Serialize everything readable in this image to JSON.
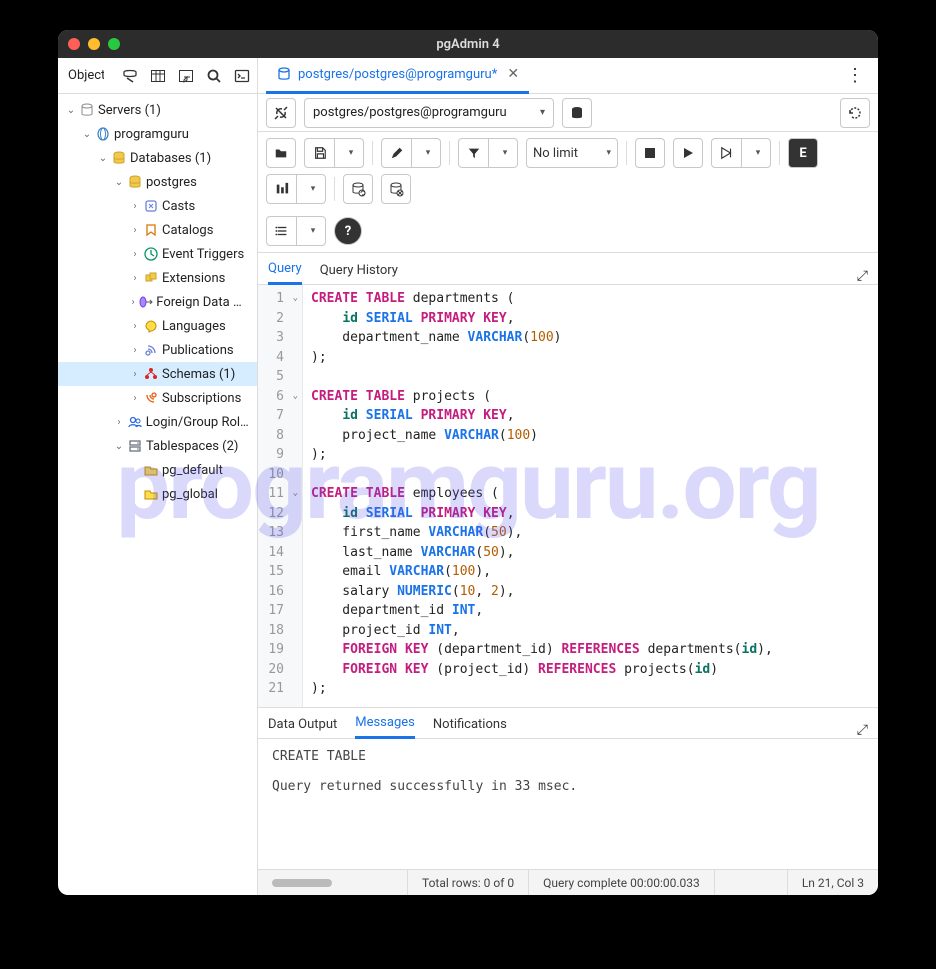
{
  "window": {
    "title": "pgAdmin 4"
  },
  "watermark": "programguru.org",
  "sidebar": {
    "tab_label": "Object",
    "items": [
      {
        "depth": 0,
        "toggle": "down",
        "icon": "servers",
        "label": "Servers (1)"
      },
      {
        "depth": 1,
        "toggle": "down",
        "icon": "server",
        "label": "programguru"
      },
      {
        "depth": 2,
        "toggle": "down",
        "icon": "database-group",
        "label": "Databases (1)"
      },
      {
        "depth": 3,
        "toggle": "down",
        "icon": "database",
        "label": "postgres"
      },
      {
        "depth": 4,
        "toggle": "right",
        "icon": "casts",
        "label": "Casts"
      },
      {
        "depth": 4,
        "toggle": "right",
        "icon": "catalogs",
        "label": "Catalogs"
      },
      {
        "depth": 4,
        "toggle": "right",
        "icon": "event",
        "label": "Event Triggers"
      },
      {
        "depth": 4,
        "toggle": "right",
        "icon": "extensions",
        "label": "Extensions"
      },
      {
        "depth": 4,
        "toggle": "right",
        "icon": "fdw",
        "label": "Foreign Data Wrappers"
      },
      {
        "depth": 4,
        "toggle": "right",
        "icon": "languages",
        "label": "Languages"
      },
      {
        "depth": 4,
        "toggle": "right",
        "icon": "publications",
        "label": "Publications"
      },
      {
        "depth": 4,
        "toggle": "right",
        "icon": "schemas",
        "label": "Schemas (1)",
        "selected": true
      },
      {
        "depth": 4,
        "toggle": "right",
        "icon": "subscriptions",
        "label": "Subscriptions"
      },
      {
        "depth": 3,
        "toggle": "right",
        "icon": "roles",
        "label": "Login/Group Roles"
      },
      {
        "depth": 3,
        "toggle": "down",
        "icon": "tablespaces",
        "label": "Tablespaces (2)"
      },
      {
        "depth": 4,
        "toggle": "",
        "icon": "tablespace",
        "label": "pg_default"
      },
      {
        "depth": 4,
        "toggle": "",
        "icon": "tablespace",
        "label": "pg_global"
      }
    ]
  },
  "file_tab": {
    "label": "postgres/postgres@programguru*",
    "close": "✕"
  },
  "connection": {
    "text": "postgres/postgres@programguru"
  },
  "toolbar": {
    "limit": "No limit"
  },
  "query_tabs": {
    "query": "Query",
    "history": "Query History"
  },
  "code_lines": [
    {
      "n": 1,
      "fold": true,
      "html": "<span class='kw'>CREATE</span> <span class='kw'>TABLE</span> departments ("
    },
    {
      "n": 2,
      "html": "    <span class='id-col'>id</span> <span class='kw2'>SERIAL</span> <span class='kw'>PRIMARY</span> <span class='kw'>KEY</span>,"
    },
    {
      "n": 3,
      "html": "    department_name <span class='kw2'>VARCHAR</span>(<span class='num'>100</span>)"
    },
    {
      "n": 4,
      "html": ");"
    },
    {
      "n": 5,
      "html": ""
    },
    {
      "n": 6,
      "fold": true,
      "html": "<span class='kw'>CREATE</span> <span class='kw'>TABLE</span> projects ("
    },
    {
      "n": 7,
      "html": "    <span class='id-col'>id</span> <span class='kw2'>SERIAL</span> <span class='kw'>PRIMARY</span> <span class='kw'>KEY</span>,"
    },
    {
      "n": 8,
      "html": "    project_name <span class='kw2'>VARCHAR</span>(<span class='num'>100</span>)"
    },
    {
      "n": 9,
      "html": ");"
    },
    {
      "n": 10,
      "html": ""
    },
    {
      "n": 11,
      "fold": true,
      "html": "<span class='kw'>CREATE</span> <span class='kw'>TABLE</span> employees ("
    },
    {
      "n": 12,
      "html": "    <span class='id-col'>id</span> <span class='kw2'>SERIAL</span> <span class='kw'>PRIMARY</span> <span class='kw'>KEY</span>,"
    },
    {
      "n": 13,
      "html": "    first_name <span class='kw2'>VARCHAR</span>(<span class='num'>50</span>),"
    },
    {
      "n": 14,
      "html": "    last_name <span class='kw2'>VARCHAR</span>(<span class='num'>50</span>),"
    },
    {
      "n": 15,
      "html": "    email <span class='kw2'>VARCHAR</span>(<span class='num'>100</span>),"
    },
    {
      "n": 16,
      "html": "    salary <span class='kw2'>NUMERIC</span>(<span class='num'>10</span>, <span class='num'>2</span>),"
    },
    {
      "n": 17,
      "html": "    department_id <span class='kw2'>INT</span>,"
    },
    {
      "n": 18,
      "html": "    project_id <span class='kw2'>INT</span>,"
    },
    {
      "n": 19,
      "html": "    <span class='kw'>FOREIGN</span> <span class='kw'>KEY</span> (department_id) <span class='kw'>REFERENCES</span> departments(<span class='id-col'>id</span>),"
    },
    {
      "n": 20,
      "html": "    <span class='kw'>FOREIGN</span> <span class='kw'>KEY</span> (project_id) <span class='kw'>REFERENCES</span> projects(<span class='id-col'>id</span>)"
    },
    {
      "n": 21,
      "html": ");"
    }
  ],
  "output_tabs": {
    "data": "Data Output",
    "messages": "Messages",
    "notifications": "Notifications"
  },
  "messages": "CREATE TABLE\n\nQuery returned successfully in 33 msec.",
  "status": {
    "rows": "Total rows: 0 of 0",
    "complete": "Query complete 00:00:00.033",
    "cursor": "Ln 21, Col 3"
  }
}
